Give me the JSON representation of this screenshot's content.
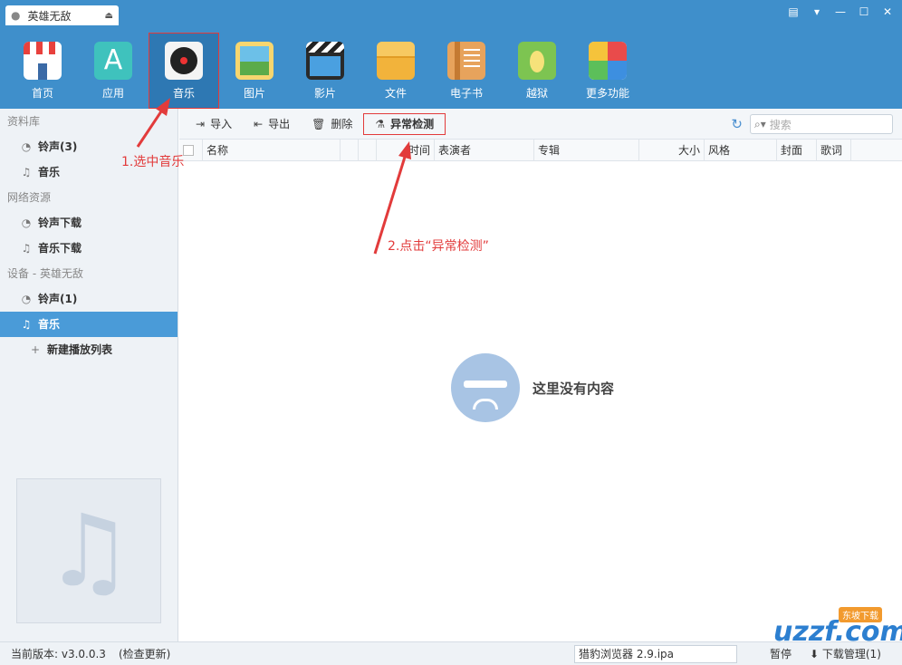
{
  "window": {
    "device_tab": "英雄无敌",
    "controls": [
      "chat-icon",
      "dropdown-icon",
      "minimize-icon",
      "maximize-icon",
      "close-icon"
    ]
  },
  "nav": [
    {
      "label": "首页",
      "icon": "home-icon"
    },
    {
      "label": "应用",
      "icon": "app-store-icon"
    },
    {
      "label": "音乐",
      "icon": "music-disc-icon",
      "active": true
    },
    {
      "label": "图片",
      "icon": "picture-icon"
    },
    {
      "label": "影片",
      "icon": "clapperboard-icon"
    },
    {
      "label": "文件",
      "icon": "file-envelope-icon"
    },
    {
      "label": "电子书",
      "icon": "ebook-icon"
    },
    {
      "label": "越狱",
      "icon": "pineapple-icon"
    },
    {
      "label": "更多功能",
      "icon": "more-tiles-icon"
    }
  ],
  "sidebar": {
    "sections": [
      {
        "title": "资料库",
        "items": [
          {
            "label": "铃声(3)",
            "icon": "bell-icon"
          },
          {
            "label": "音乐",
            "icon": "music-note-icon"
          }
        ]
      },
      {
        "title": "网络资源",
        "items": [
          {
            "label": "铃声下载",
            "icon": "bell-icon"
          },
          {
            "label": "音乐下载",
            "icon": "music-note-icon"
          }
        ]
      },
      {
        "title": "设备 - 英雄无敌",
        "items": [
          {
            "label": "铃声(1)",
            "icon": "bell-icon"
          },
          {
            "label": "音乐",
            "icon": "music-note-icon",
            "active": true
          },
          {
            "label": "新建播放列表",
            "icon": "plus-icon"
          }
        ]
      }
    ]
  },
  "toolbar": {
    "import": "导入",
    "export": "导出",
    "delete": "删除",
    "check": "异常检测",
    "search_placeholder": "搜索"
  },
  "columns": [
    "名称",
    "时间",
    "表演者",
    "专辑",
    "大小",
    "风格",
    "封面",
    "歌词"
  ],
  "empty_text": "这里没有内容",
  "annotations": {
    "step1": "1.选中音乐",
    "step2": "2.点击“异常检测”"
  },
  "status": {
    "version": "当前版本: v3.0.0.3",
    "update": "(检查更新)",
    "download_file": "猎豹浏览器  2.9.ipa",
    "pause": "暂停",
    "download_manager": "下载管理(1)"
  },
  "watermark": {
    "brand": "uzzf.com",
    "tag": "东坡下载"
  },
  "colors": {
    "header": "#3f8fcb",
    "accent": "#4a9bd8",
    "annotation": "#e23b3b"
  }
}
